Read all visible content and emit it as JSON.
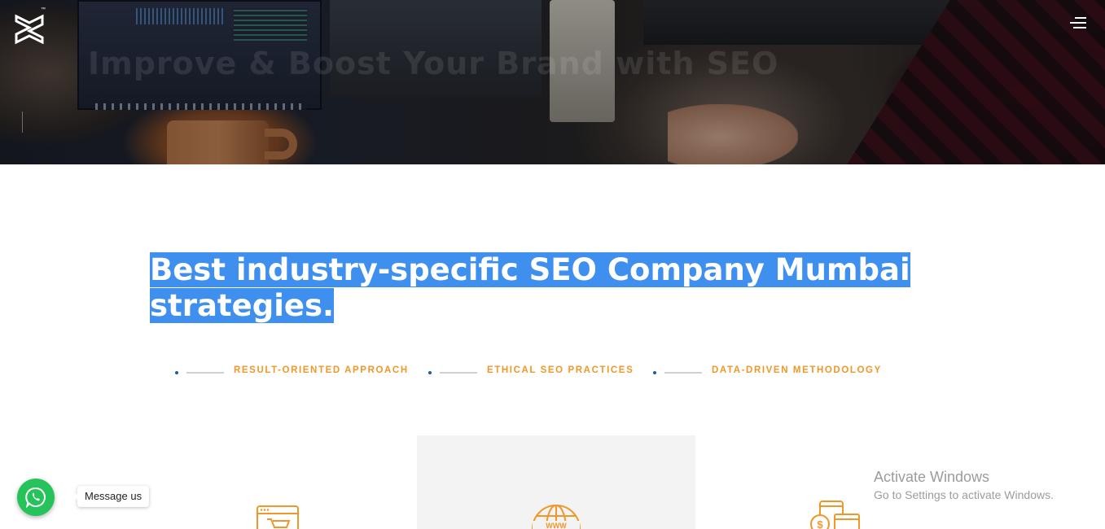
{
  "hero": {
    "ghost_title": "Improve & Boost Your Brand with SEO"
  },
  "header": {
    "logo_tm": "™",
    "menu_icon": "hamburger-menu-icon"
  },
  "main": {
    "heading_line1": "Best industry-specific SEO Company Mumbai",
    "heading_line2": "strategies.",
    "features": [
      {
        "label": "RESULT-ORIENTED APPROACH"
      },
      {
        "label": "ETHICAL SEO PRACTICES"
      },
      {
        "label": "DATA-DRIVEN METHODOLOGY"
      }
    ],
    "cards": [
      {
        "icon": "ecommerce-browser-cart-icon"
      },
      {
        "icon": "www-globe-icon"
      },
      {
        "icon": "money-devices-icon"
      }
    ]
  },
  "chat": {
    "label": "Message us",
    "icon": "whatsapp-icon"
  },
  "watermark": {
    "title": "Activate Windows",
    "subtitle": "Go to Settings to activate Windows."
  },
  "colors": {
    "accent": "#f0972a",
    "highlight": "#3f8fef",
    "whatsapp": "#25c35a",
    "dot": "#1f5ba8"
  }
}
